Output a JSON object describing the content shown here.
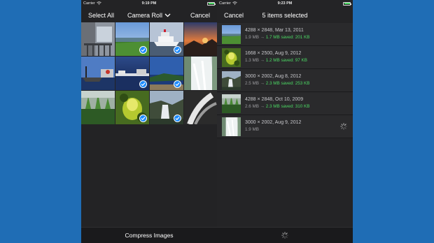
{
  "left": {
    "status": {
      "carrier": "Carrier",
      "time": "9:19 PM"
    },
    "nav": {
      "select_all": "Select All",
      "title": "Camera Roll",
      "cancel": "Cancel"
    },
    "photos": [
      {
        "scene": "balcony",
        "selected": false
      },
      {
        "scene": "grass",
        "selected": true
      },
      {
        "scene": "ship",
        "selected": true
      },
      {
        "scene": "sunset",
        "selected": false
      },
      {
        "scene": "boat",
        "selected": false
      },
      {
        "scene": "harbor",
        "selected": true
      },
      {
        "scene": "bay",
        "selected": true
      },
      {
        "scene": "waterfall",
        "selected": false
      },
      {
        "scene": "plants",
        "selected": false
      },
      {
        "scene": "pitcher",
        "selected": true
      },
      {
        "scene": "cliffs",
        "selected": true
      },
      {
        "scene": "bwfern",
        "selected": false
      }
    ],
    "bottom_label": "Compress Images"
  },
  "right": {
    "status": {
      "carrier": "Carrier",
      "time": "9:23 PM"
    },
    "nav": {
      "cancel": "Cancel",
      "title": "5 items selected"
    },
    "items": [
      {
        "scene": "grass",
        "line1": "4288 × 2848, Mar 13, 2011",
        "size": "1.9 MB",
        "arrow": " → ",
        "new_size": "1.7 MB",
        "saved": "saved: 201 KB",
        "processing": false
      },
      {
        "scene": "pitcher",
        "line1": "1668 × 2500, Aug 9, 2012",
        "size": "1.3 MB",
        "arrow": " → ",
        "new_size": "1.2 MB",
        "saved": "saved: 97 KB",
        "processing": false
      },
      {
        "scene": "cliffs",
        "line1": "3000 × 2002, Aug 8, 2012",
        "size": "2.5 MB",
        "arrow": " → ",
        "new_size": "2.3 MB",
        "saved": "saved: 253 KB",
        "processing": false
      },
      {
        "scene": "plants",
        "line1": "4288 × 2848, Oct 10, 2009",
        "size": "2.6 MB",
        "arrow": " → ",
        "new_size": "2.3 MB",
        "saved": "saved: 310 KB",
        "processing": false
      },
      {
        "scene": "waterfall",
        "line1": "3000 × 2002, Aug 9, 2012",
        "size": "1.9 MB",
        "arrow": "",
        "new_size": "",
        "saved": "",
        "processing": true
      }
    ]
  },
  "colors": {
    "background": "#1f6db5",
    "check": "#1e8cff",
    "saved": "#4cd964"
  }
}
